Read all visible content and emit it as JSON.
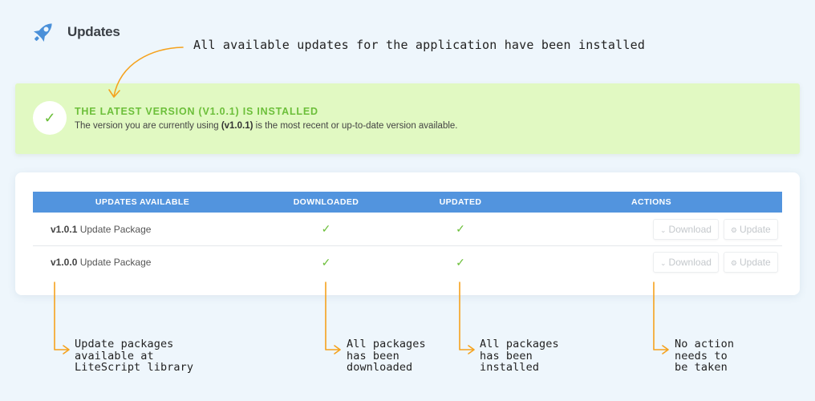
{
  "header": {
    "title": "Updates",
    "icon": "rocket-icon"
  },
  "annotations": {
    "top": "All available updates for the application have been installed",
    "col1": [
      "Update packages",
      "available at",
      "LiteScript library"
    ],
    "col2": [
      "All packages",
      "has been",
      "downloaded"
    ],
    "col3": [
      "All packages",
      "has been",
      "installed"
    ],
    "col4": [
      "No action",
      "needs to",
      "be taken"
    ],
    "arrow_color": "#f5a21d"
  },
  "status": {
    "title": "THE LATEST VERSION (V1.0.1) IS INSTALLED",
    "desc_before": "The version you are currently using ",
    "desc_version": "(v1.0.1)",
    "desc_after": " is the most recent or up-to-date version available.",
    "color": "#6cbf3a"
  },
  "table": {
    "headers": [
      "UPDATES AVAILABLE",
      "DOWNLOADED",
      "UPDATED",
      "ACTIONS"
    ],
    "header_color": "#5294de",
    "rows": [
      {
        "version": "v1.0.1",
        "label": " Update Package",
        "downloaded": "✓",
        "updated": "✓",
        "download_label": "Download",
        "update_label": "Update"
      },
      {
        "version": "v1.0.0",
        "label": " Update Package",
        "downloaded": "✓",
        "updated": "✓",
        "download_label": "Download",
        "update_label": "Update"
      }
    ]
  }
}
